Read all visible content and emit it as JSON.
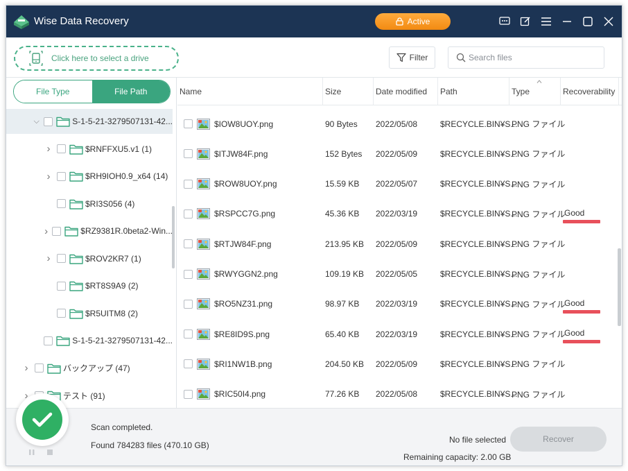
{
  "app": {
    "title": "Wise Data Recovery",
    "active_label": "Active"
  },
  "toolbar": {
    "drive_select_label": "Click here to select a drive",
    "filter_label": "Filter",
    "search_placeholder": "Search files"
  },
  "left_panel": {
    "tabs": {
      "file_type": "File Type",
      "file_path": "File Path"
    },
    "tree": [
      {
        "label": "S-1-5-21-3279507131-42...",
        "expander": "down",
        "selected": true
      },
      {
        "label": "$RNFFXU5.v1 (1)",
        "expander": "right"
      },
      {
        "label": "$RH9IOH0.9_x64 (14)",
        "expander": "right"
      },
      {
        "label": "$RI3S056 (4)",
        "expander": "none"
      },
      {
        "label": "$RZ9381R.0beta2-Win...",
        "expander": "right"
      },
      {
        "label": "$ROV2KR7 (1)",
        "expander": "right"
      },
      {
        "label": "$RT8S9A9 (2)",
        "expander": "none"
      },
      {
        "label": "$R5UITM8 (2)",
        "expander": "none"
      },
      {
        "label": "S-1-5-21-3279507131-42...",
        "expander": "none"
      },
      {
        "label": "バックアップ (47)",
        "expander": "right"
      },
      {
        "label": "テスト (91)",
        "expander": "right"
      }
    ]
  },
  "table": {
    "columns": [
      "Name",
      "Size",
      "Date modified",
      "Path",
      "Type",
      "Recoverability"
    ],
    "rows": [
      {
        "name": "$IOW8UOY.png",
        "size": "90 Bytes",
        "date": "2022/05/08",
        "path": "$RECYCLE.BIN¥S...",
        "type": "PNG ファイル",
        "recoverability": ""
      },
      {
        "name": "$ITJW84F.png",
        "size": "152 Bytes",
        "date": "2022/05/09",
        "path": "$RECYCLE.BIN¥S...",
        "type": "PNG ファイル",
        "recoverability": ""
      },
      {
        "name": "$ROW8UOY.png",
        "size": "15.59 KB",
        "date": "2022/05/07",
        "path": "$RECYCLE.BIN¥S...",
        "type": "PNG ファイル",
        "recoverability": ""
      },
      {
        "name": "$RSPCC7G.png",
        "size": "45.36 KB",
        "date": "2022/03/19",
        "path": "$RECYCLE.BIN¥S...",
        "type": "PNG ファイル",
        "recoverability": "Good"
      },
      {
        "name": "$RTJW84F.png",
        "size": "213.95 KB",
        "date": "2022/05/09",
        "path": "$RECYCLE.BIN¥S...",
        "type": "PNG ファイル",
        "recoverability": ""
      },
      {
        "name": "$RWYGGN2.png",
        "size": "109.19 KB",
        "date": "2022/05/05",
        "path": "$RECYCLE.BIN¥S...",
        "type": "PNG ファイル",
        "recoverability": ""
      },
      {
        "name": "$RO5NZ31.png",
        "size": "98.97 KB",
        "date": "2022/03/19",
        "path": "$RECYCLE.BIN¥S...",
        "type": "PNG ファイル",
        "recoverability": "Good"
      },
      {
        "name": "$RE8ID9S.png",
        "size": "65.40 KB",
        "date": "2022/03/19",
        "path": "$RECYCLE.BIN¥S...",
        "type": "PNG ファイル",
        "recoverability": "Good"
      },
      {
        "name": "$RI1NW1B.png",
        "size": "204.50 KB",
        "date": "2022/05/09",
        "path": "$RECYCLE.BIN¥S...",
        "type": "PNG ファイル",
        "recoverability": ""
      },
      {
        "name": "$RIC50I4.png",
        "size": "77.26 KB",
        "date": "2022/05/08",
        "path": "$RECYCLE.BIN¥S...",
        "type": "PNG ファイル",
        "recoverability": ""
      }
    ]
  },
  "footer": {
    "scan_status": "Scan completed.",
    "found_text": "Found 784283 files (470.10 GB)",
    "selection_text": "No file selected",
    "remaining_text": "Remaining capacity: 2.00 GB",
    "recover_label": "Recover"
  },
  "colors": {
    "titlebar": "#1c3454",
    "accent_green": "#3aa57f",
    "active_orange": "#f28a12",
    "good_bar": "#e8505b",
    "success_green": "#2fb064"
  }
}
